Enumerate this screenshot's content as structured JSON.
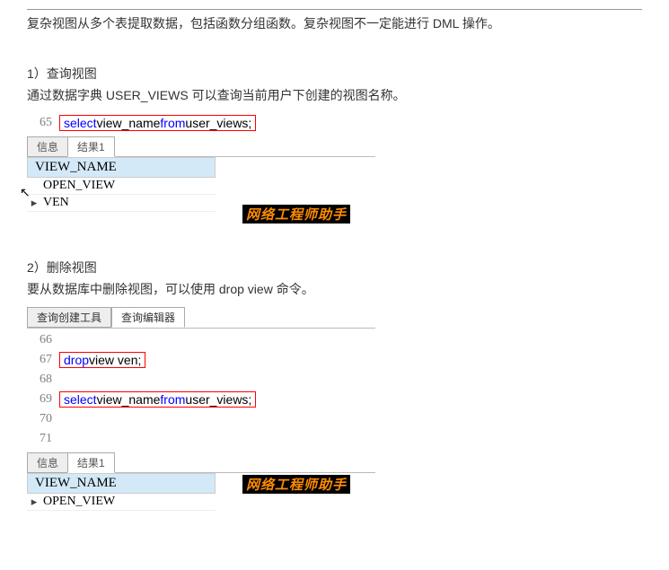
{
  "intro": "复杂视图从多个表提取数据，包括函数分组函数。复杂视图不一定能进行 DML 操作。",
  "section1": {
    "heading": "1）查询视图",
    "desc": "通过数据字典 USER_VIEWS 可以查询当前用户下创建的视图名称。",
    "code": {
      "lineNo": "65",
      "kw_select": "select",
      "sp1": " view_name ",
      "kw_from": "from",
      "sp2": " user_views;"
    },
    "tabs": {
      "info": "信息",
      "result": "结果1"
    },
    "result": {
      "header": "VIEW_NAME",
      "rows": [
        "OPEN_VIEW",
        "VEN"
      ]
    },
    "watermark": "网络工程师助手"
  },
  "section2": {
    "heading": "2）删除视图",
    "desc": "要从数据库中删除视图，可以使用 drop view 命令。",
    "topTabs": {
      "builder": "查询创建工具",
      "editor": "查询编辑器"
    },
    "code": {
      "l66": "66",
      "l67": "67",
      "l67_drop": "drop",
      "l67_txt": " view ven;",
      "l68": "68",
      "l69": "69",
      "l69_select": "select",
      "l69_sp1": " view_name ",
      "l69_from": "from",
      "l69_sp2": " user_views;",
      "l70": "70",
      "l71": "71"
    },
    "tabs": {
      "info": "信息",
      "result": "结果1"
    },
    "result": {
      "header": "VIEW_NAME",
      "rows": [
        "OPEN_VIEW"
      ]
    },
    "watermark": "网络工程师助手"
  }
}
